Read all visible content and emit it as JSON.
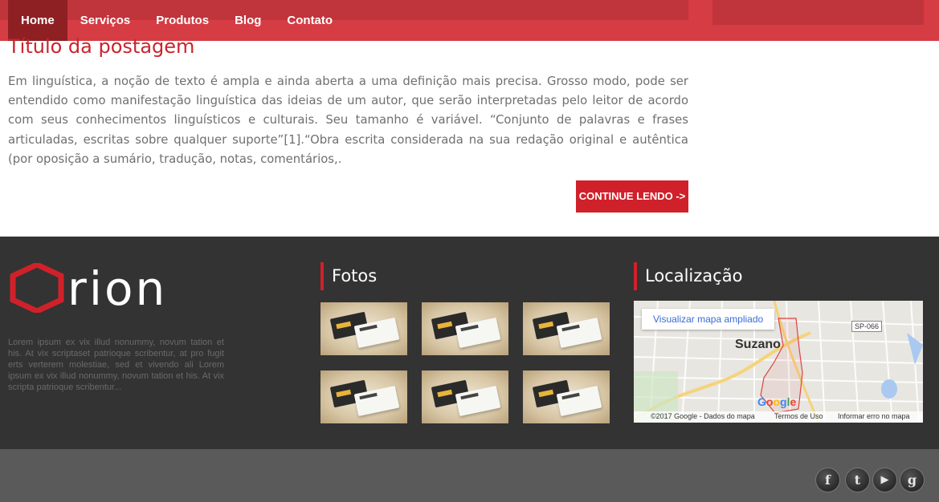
{
  "nav": {
    "items": [
      "Home",
      "Serviços",
      "Produtos",
      "Blog",
      "Contato"
    ],
    "active": "Home"
  },
  "post": {
    "title": "Título da postagem",
    "body": "Em linguística, a noção de texto é ampla e ainda aberta a uma definição mais precisa. Grosso modo, pode ser entendido como manifestação linguística das ideias de um autor, que serão interpretadas pelo leitor de acordo com seus conhecimentos linguísticos e culturais. Seu tamanho é variável. “Conjunto de palavras e frases articuladas, escritas sobre qualquer suporte”[1].“Obra escrita considerada na sua redação original e autêntica (por oposição a sumário, tradução, notas, comentários,.",
    "continue_label": "CONTINUE LENDO ->"
  },
  "footer": {
    "logo_text": "Orion",
    "about": "Lorem ipsum ex vix illud nonummy, novum tation et his. At vix scriptaset patrioque scribentur, at pro fugit erts verterem molestiae, sed et vivendo ali Lorem ipsum ex vix illud nonummy, novum tation et his. At vix scripta patrioque scribentur...",
    "photos_title": "Fotos",
    "photos_count": 6,
    "location_title": "Localização",
    "map": {
      "link_label": "Visualizar mapa ampliado",
      "city": "Suzano",
      "road": "SP-066",
      "brand": "Google",
      "attribution": "©2017 Google - Dados do mapa",
      "terms": "Termos de Uso",
      "report": "Informar erro no mapa"
    }
  },
  "social": {
    "icons": [
      "facebook-icon",
      "twitter-icon",
      "youtube-icon",
      "google-plus-icon"
    ],
    "glyphs": [
      "f",
      "t",
      "▶",
      "g"
    ]
  },
  "colors": {
    "accent": "#d0212a",
    "nav_bg": "#d63c43",
    "nav_active": "#8e2024",
    "footer_bg": "#333333",
    "bottom_bg": "#5a5a5a"
  }
}
